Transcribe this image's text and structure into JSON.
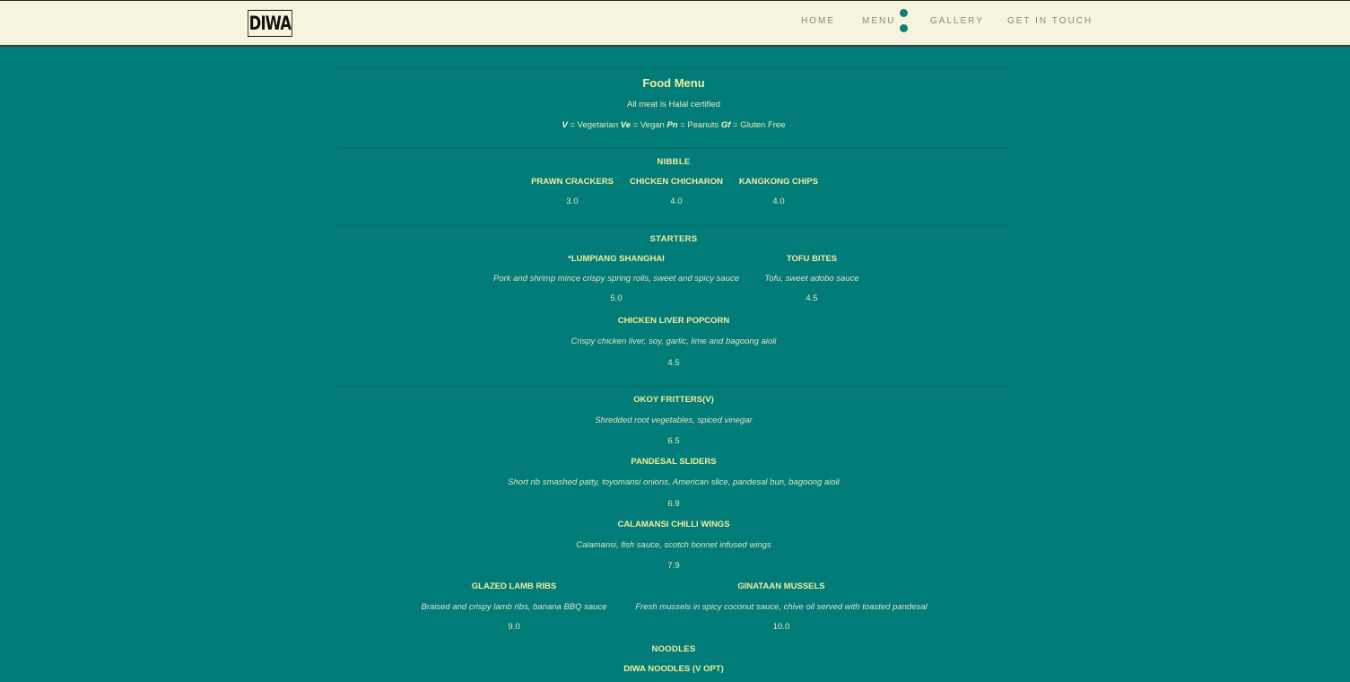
{
  "header": {
    "logo": "DIWA",
    "nav": [
      {
        "label": "HOME"
      },
      {
        "label": "MENU"
      },
      {
        "label": "GALLERY"
      },
      {
        "label": "GET IN TOUCH"
      }
    ]
  },
  "menu": {
    "title": "Food Menu",
    "halal_note": "All meat is Halal certified",
    "legend": [
      {
        "code": "V",
        "meaning": " = Vegetarian "
      },
      {
        "code": "Ve",
        "meaning": " = Vegan "
      },
      {
        "code": "Pn",
        "meaning": " = Peanuts "
      },
      {
        "code": "Gf",
        "meaning": " = Gluten Free"
      }
    ],
    "nibble": {
      "title": "NIBBLE",
      "items": [
        {
          "name": "PRAWN CRACKERS",
          "price": "3.0"
        },
        {
          "name": "CHICKEN CHICHARON",
          "price": "4.0"
        },
        {
          "name": "KANGKONG CHIPS",
          "price": "4.0"
        }
      ]
    },
    "starters": {
      "title": "STARTERS",
      "items": [
        {
          "name": "*LUMPIANG SHANGHAI",
          "desc": "Pork and shrimp mince crispy spring rolls, sweet and spicy sauce",
          "price": "5.0"
        },
        {
          "name": "TOFU BITES",
          "desc": "Tofu, sweet adobo sauce",
          "price": "4.5"
        },
        {
          "name": "CHICKEN LIVER POPCORN",
          "desc": "Crispy chicken liver, soy, garlic, lime and bagoong aioli",
          "price": "4.5"
        }
      ]
    },
    "mains": {
      "items": [
        {
          "name": "OKOY FRITTERS(V)",
          "desc": "Shredded root vegetables, spiced vinegar",
          "price": "6.5"
        },
        {
          "name": "PANDESAL SLIDERS",
          "desc": "Short rib smashed patty, toyomansi onions, American slice, pandesal bun, bagoong aioli",
          "price": "6.9"
        },
        {
          "name": "CALAMANSI CHILLI WINGS",
          "desc": "Calamansi, fish sauce, scotch bonnet infused wings",
          "price": "7.9"
        },
        {
          "name": "GLAZED LAMB RIBS",
          "desc": "Braised and crispy lamb ribs, banana BBQ sauce",
          "price": "9.0"
        },
        {
          "name": "GINATAAN MUSSELS",
          "desc": "Fresh mussels in spicy coconut sauce, chive oil served with toasted pandesal",
          "price": "10.0"
        }
      ]
    },
    "noodles": {
      "title": "NOODLES",
      "items": [
        {
          "name": "DIWA NOODLES (V OPT)"
        }
      ]
    }
  },
  "colors": {
    "background": "#017c79",
    "header_bg": "#f6f4dd",
    "accent_text": "#f3ec9e",
    "nav_dot": "#0d7f7b"
  }
}
